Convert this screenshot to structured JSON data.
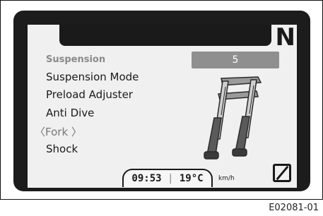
{
  "display": {
    "gear": "N",
    "section_label": "Suspension",
    "selected_value": "5",
    "menu": [
      {
        "label": "Suspension Mode"
      },
      {
        "label": "Preload Adjuster"
      },
      {
        "label": "Anti Dive"
      },
      {
        "label": "Fork"
      },
      {
        "label": "Shock"
      }
    ],
    "chevron_left": "〈",
    "chevron_right": "〉",
    "status": {
      "time": "09:53",
      "separator": "|",
      "temperature": "19°C",
      "speed_unit": "km/h"
    },
    "icons": {
      "mode": "ride-mode-icon",
      "fork": "suspension-fork-icon"
    }
  },
  "figure_code": "E02081-01"
}
